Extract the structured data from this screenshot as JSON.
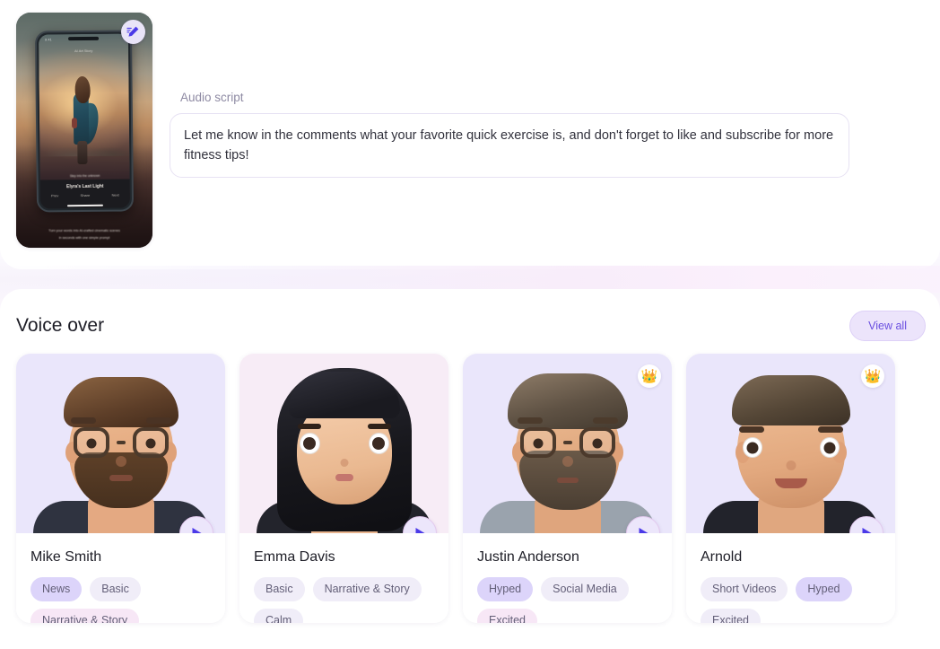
{
  "top_panel": {
    "thumbnail": {
      "edit_icon": "edit-pencil-icon",
      "phone_status_text": "9:41",
      "phone_top_title": "AI Art Story",
      "phone_caption": "Step into the unknown",
      "phone_footer_title": "Elyra's Last Light",
      "phone_controls": [
        "Prev",
        "Share",
        "Next"
      ],
      "overlay_line_1": "Turn your words into AI-crafted cinematic scenes",
      "overlay_line_2": "in seconds with one simple prompt"
    },
    "script_label": "Audio script",
    "script_text": "Let me know in the comments what your favorite quick exercise is, and don't forget to like and subscribe for more fitness tips!"
  },
  "voice_over": {
    "title": "Voice over",
    "view_all_label": "View all",
    "cards": [
      {
        "name": "Mike Smith",
        "art_bg": "#eae6fb",
        "premium": false,
        "crown_icon": "",
        "play_icon": "play-icon",
        "tags": [
          {
            "label": "News",
            "style": "lav"
          },
          {
            "label": "Basic",
            "style": "light"
          },
          {
            "label": "Narrative & Story",
            "style": "pink"
          }
        ]
      },
      {
        "name": "Emma Davis",
        "art_bg": "#f7ecf6",
        "premium": false,
        "crown_icon": "",
        "play_icon": "play-icon",
        "tags": [
          {
            "label": "Basic",
            "style": "light"
          },
          {
            "label": "Narrative & Story",
            "style": "light"
          },
          {
            "label": "Calm",
            "style": "light"
          }
        ]
      },
      {
        "name": "Justin Anderson",
        "art_bg": "#eae6fb",
        "premium": true,
        "crown_icon": "👑",
        "play_icon": "play-icon",
        "tags": [
          {
            "label": "Hyped",
            "style": "lav"
          },
          {
            "label": "Social Media",
            "style": "light"
          },
          {
            "label": "Excited",
            "style": "pink"
          }
        ]
      },
      {
        "name": "Arnold",
        "art_bg": "#eae6fb",
        "premium": true,
        "crown_icon": "👑",
        "play_icon": "play-icon",
        "tags": [
          {
            "label": "Short Videos",
            "style": "light"
          },
          {
            "label": "Hyped",
            "style": "lav"
          },
          {
            "label": "Excited",
            "style": "light"
          }
        ]
      }
    ]
  },
  "colors": {
    "accent_purple": "#6a4fe0",
    "play_triangle": "#4b3ae8",
    "tag_lavender": "#dcd4fa",
    "tag_light": "#f0edf8",
    "tag_pink": "#f7e7f6",
    "panel_white": "#ffffff",
    "text_dark": "#1d1d26",
    "text_muted": "#8e8aa3"
  }
}
